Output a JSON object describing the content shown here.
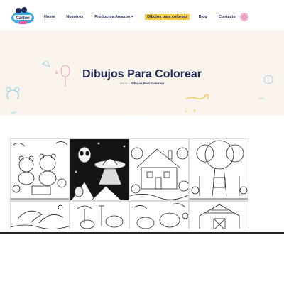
{
  "brand": {
    "logo_alt": "Caricatoo logo",
    "accent": "#f6c945",
    "navy": "#1e2a5a"
  },
  "nav": {
    "items": [
      {
        "label": "Home"
      },
      {
        "label": "Nosotros"
      },
      {
        "label": "Productos Amazon +"
      },
      {
        "label": "Dibujos para colorear",
        "active": true
      },
      {
        "label": "Blog"
      },
      {
        "label": "Contacto"
      }
    ],
    "cart_icon": "cart-icon"
  },
  "hero": {
    "title": "Dibujos Para Colorear",
    "breadcrumb": {
      "home": "Inicio",
      "separator": "»",
      "current": "Dibujos Para Colorear"
    }
  },
  "gallery": {
    "row1": [
      {
        "name": "bears-picnic-drawing"
      },
      {
        "name": "alien-ufo-drawing"
      },
      {
        "name": "cottage-garden-drawing"
      },
      {
        "name": "treehouse-forest-drawing"
      }
    ],
    "row2": [
      {
        "name": "dolphins-ocean-drawing"
      },
      {
        "name": "safari-animals-drawing"
      },
      {
        "name": "jungle-animals-drawing"
      },
      {
        "name": "barn-farm-drawing"
      }
    ]
  }
}
